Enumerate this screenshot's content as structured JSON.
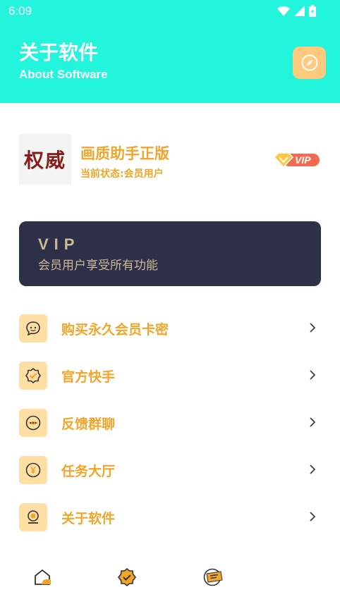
{
  "status_bar": {
    "time": "6:09"
  },
  "header": {
    "title": "关于软件",
    "subtitle": "About Software",
    "compass_icon": "compass-icon"
  },
  "profile": {
    "avatar_text": "权威",
    "app_name": "画质助手正版",
    "status": "当前状态:会员用户",
    "badge": "VIP"
  },
  "vip_card": {
    "title": "VIP",
    "description": "会员用户享受所有功能"
  },
  "menu": {
    "items": [
      {
        "label": "购买永久会员卡密",
        "icon": "chat-face-icon"
      },
      {
        "label": "官方快手",
        "icon": "verified-badge-icon"
      },
      {
        "label": "反馈群聊",
        "icon": "message-dots-icon"
      },
      {
        "label": "任务大厅",
        "icon": "yuan-coin-icon"
      },
      {
        "label": "关于软件",
        "icon": "user-info-icon"
      }
    ]
  },
  "bottom_nav": {
    "items": [
      {
        "icon": "home-icon"
      },
      {
        "icon": "badge-check-icon"
      },
      {
        "icon": "about-icon"
      }
    ]
  },
  "colors": {
    "header_bg": "#22f5dc",
    "accent": "#f2a52a",
    "card_bg": "#2e3048",
    "icon_bg": "#ffdfa4"
  }
}
